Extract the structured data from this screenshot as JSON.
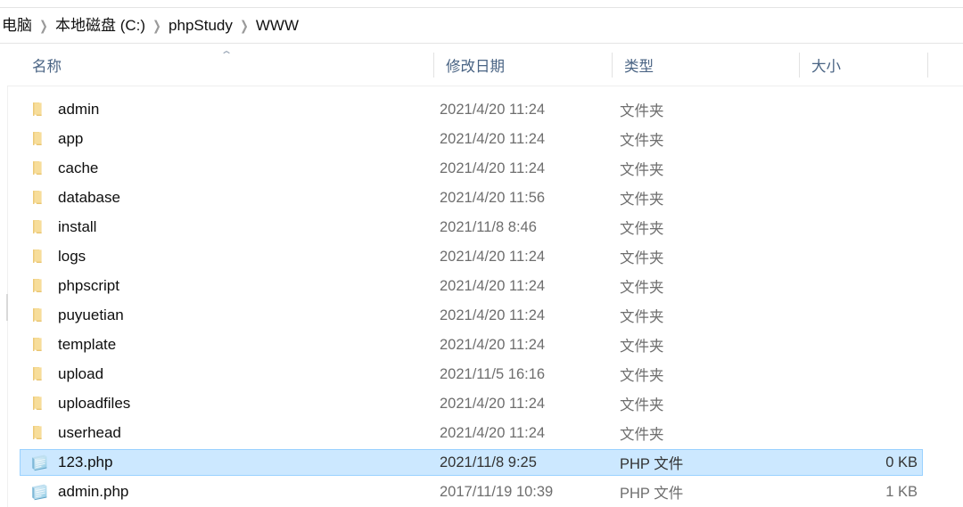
{
  "window": {
    "app": "File Explorer"
  },
  "breadcrumb": {
    "separator": "❯",
    "items": [
      {
        "label": "电脑"
      },
      {
        "label": "本地磁盘 (C:)"
      },
      {
        "label": "phpStudy"
      },
      {
        "label": "WWW"
      }
    ]
  },
  "columns": [
    {
      "key": "name",
      "label": "名称",
      "sorted": "ascending",
      "sort_glyph": "⌃"
    },
    {
      "key": "date",
      "label": "修改日期"
    },
    {
      "key": "type",
      "label": "类型"
    },
    {
      "key": "size",
      "label": "大小"
    }
  ],
  "colors": {
    "selection_fill": "#cce8ff",
    "selection_border": "#99d1ff",
    "header_text": "#4a6484",
    "folder_icon": "#f5d78e",
    "php_icon": "#8ecae6"
  },
  "files": [
    {
      "name": "admin",
      "icon": "folder-icon",
      "date": "2021/4/20 11:24",
      "type": "文件夹",
      "size": "",
      "selected": false
    },
    {
      "name": "app",
      "icon": "folder-icon",
      "date": "2021/4/20 11:24",
      "type": "文件夹",
      "size": "",
      "selected": false
    },
    {
      "name": "cache",
      "icon": "folder-icon",
      "date": "2021/4/20 11:24",
      "type": "文件夹",
      "size": "",
      "selected": false
    },
    {
      "name": "database",
      "icon": "folder-icon",
      "date": "2021/4/20 11:56",
      "type": "文件夹",
      "size": "",
      "selected": false
    },
    {
      "name": "install",
      "icon": "folder-icon",
      "date": "2021/11/8 8:46",
      "type": "文件夹",
      "size": "",
      "selected": false
    },
    {
      "name": "logs",
      "icon": "folder-icon",
      "date": "2021/4/20 11:24",
      "type": "文件夹",
      "size": "",
      "selected": false
    },
    {
      "name": "phpscript",
      "icon": "folder-icon",
      "date": "2021/4/20 11:24",
      "type": "文件夹",
      "size": "",
      "selected": false
    },
    {
      "name": "puyuetian",
      "icon": "folder-icon",
      "date": "2021/4/20 11:24",
      "type": "文件夹",
      "size": "",
      "selected": false
    },
    {
      "name": "template",
      "icon": "folder-icon",
      "date": "2021/4/20 11:24",
      "type": "文件夹",
      "size": "",
      "selected": false
    },
    {
      "name": "upload",
      "icon": "folder-icon",
      "date": "2021/11/5 16:16",
      "type": "文件夹",
      "size": "",
      "selected": false
    },
    {
      "name": "uploadfiles",
      "icon": "folder-icon",
      "date": "2021/4/20 11:24",
      "type": "文件夹",
      "size": "",
      "selected": false
    },
    {
      "name": "userhead",
      "icon": "folder-icon",
      "date": "2021/4/20 11:24",
      "type": "文件夹",
      "size": "",
      "selected": false
    },
    {
      "name": "123.php",
      "icon": "php-file-icon",
      "date": "2021/11/8 9:25",
      "type": "PHP 文件",
      "size": "0 KB",
      "selected": true
    },
    {
      "name": "admin.php",
      "icon": "php-file-icon",
      "date": "2017/11/19 10:39",
      "type": "PHP 文件",
      "size": "1 KB",
      "selected": false
    }
  ]
}
